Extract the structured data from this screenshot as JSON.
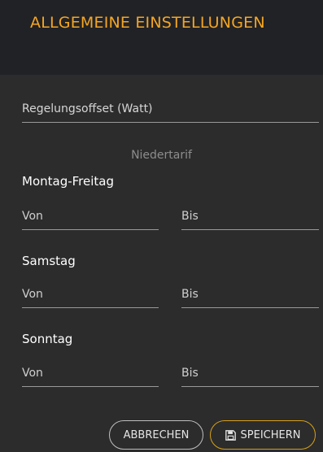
{
  "dialog": {
    "title": "ALLGEMEINE EINSTELLUNGEN"
  },
  "form": {
    "offset_placeholder": "Regelungsoffset (Watt)",
    "section_label": "Niedertarif",
    "days": [
      {
        "label": "Montag-Freitag",
        "from_placeholder": "Von",
        "to_placeholder": "Bis"
      },
      {
        "label": "Samstag",
        "from_placeholder": "Von",
        "to_placeholder": "Bis"
      },
      {
        "label": "Sonntag",
        "from_placeholder": "Von",
        "to_placeholder": "Bis"
      }
    ]
  },
  "actions": {
    "cancel_label": "ABBRECHEN",
    "save_label": "SPEICHERN",
    "save_icon": "floppy-disk-icon"
  },
  "colors": {
    "accent": "#f5a623",
    "header_bg": "#212226",
    "body_bg": "#2c2c2c"
  }
}
